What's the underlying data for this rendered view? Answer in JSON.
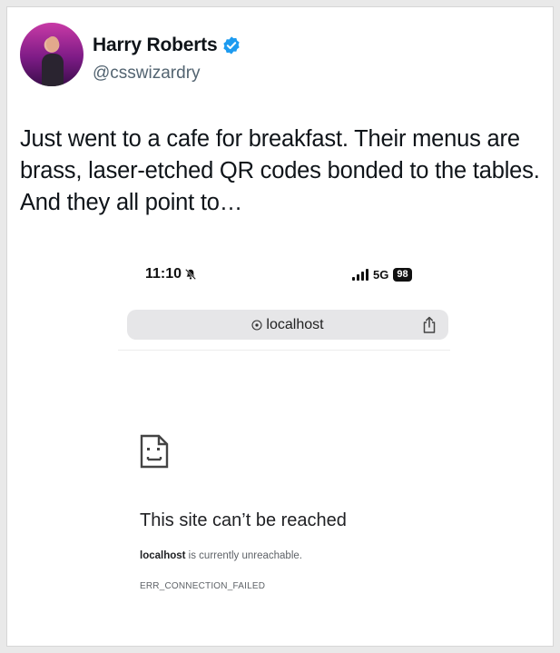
{
  "tweet": {
    "author_name": "Harry Roberts",
    "handle": "@csswizardry",
    "text": "Just went to a cafe for breakfast. Their menus are brass, laser-etched QR codes bonded to the tables. And they all point to…"
  },
  "phone": {
    "time": "11:10",
    "network": "5G",
    "battery": "98",
    "url": "localhost"
  },
  "error": {
    "title": "This site can’t be reached",
    "host": "localhost",
    "message": " is currently unreachable.",
    "code": "ERR_CONNECTION_FAILED"
  },
  "colors": {
    "verified_badge": "#1d9bf0",
    "handle_gray": "#536471",
    "url_bar": "#e6e6e8"
  },
  "icons": {
    "verified": "verified-badge-icon",
    "silent": "bell-slash-icon",
    "signal": "signal-bars-icon",
    "url_info": "info-icon",
    "share": "share-icon",
    "error_page": "sad-document-icon"
  }
}
